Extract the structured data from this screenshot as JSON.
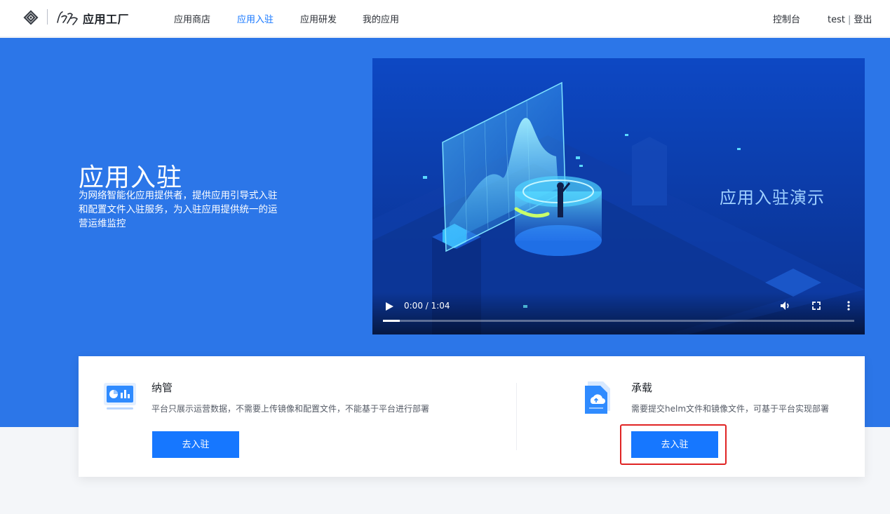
{
  "header": {
    "app_title": "应用工厂",
    "nav": [
      "应用商店",
      "应用入驻",
      "应用研发",
      "我的应用"
    ],
    "active_index": 1,
    "console_label": "控制台",
    "username": "test",
    "user_sep": "|",
    "logout_label": "登出"
  },
  "hero": {
    "title": "应用入驻",
    "description": "为网络智能化应用提供者，提供应用引导式入驻和配置文件入驻服务，为入驻应用提供统一的运营运维监控",
    "video": {
      "caption": "应用入驻演示",
      "time": "0:00 / 1:04",
      "progress_fraction": 0.036
    }
  },
  "options": [
    {
      "title": "纳管",
      "description": "平台只展示运营数据，不需要上传镜像和配置文件，不能基于平台进行部署",
      "button": "去入驻",
      "icon": "dashboard-monitor-icon"
    },
    {
      "title": "承载",
      "description": "需要提交helm文件和镜像文件，可基于平台实现部署",
      "button": "去入驻",
      "icon": "cloud-upload-file-icon"
    }
  ],
  "colors": {
    "accent": "#1677ff",
    "hero_bg": "#2c76e8",
    "highlight": "#e02424"
  }
}
